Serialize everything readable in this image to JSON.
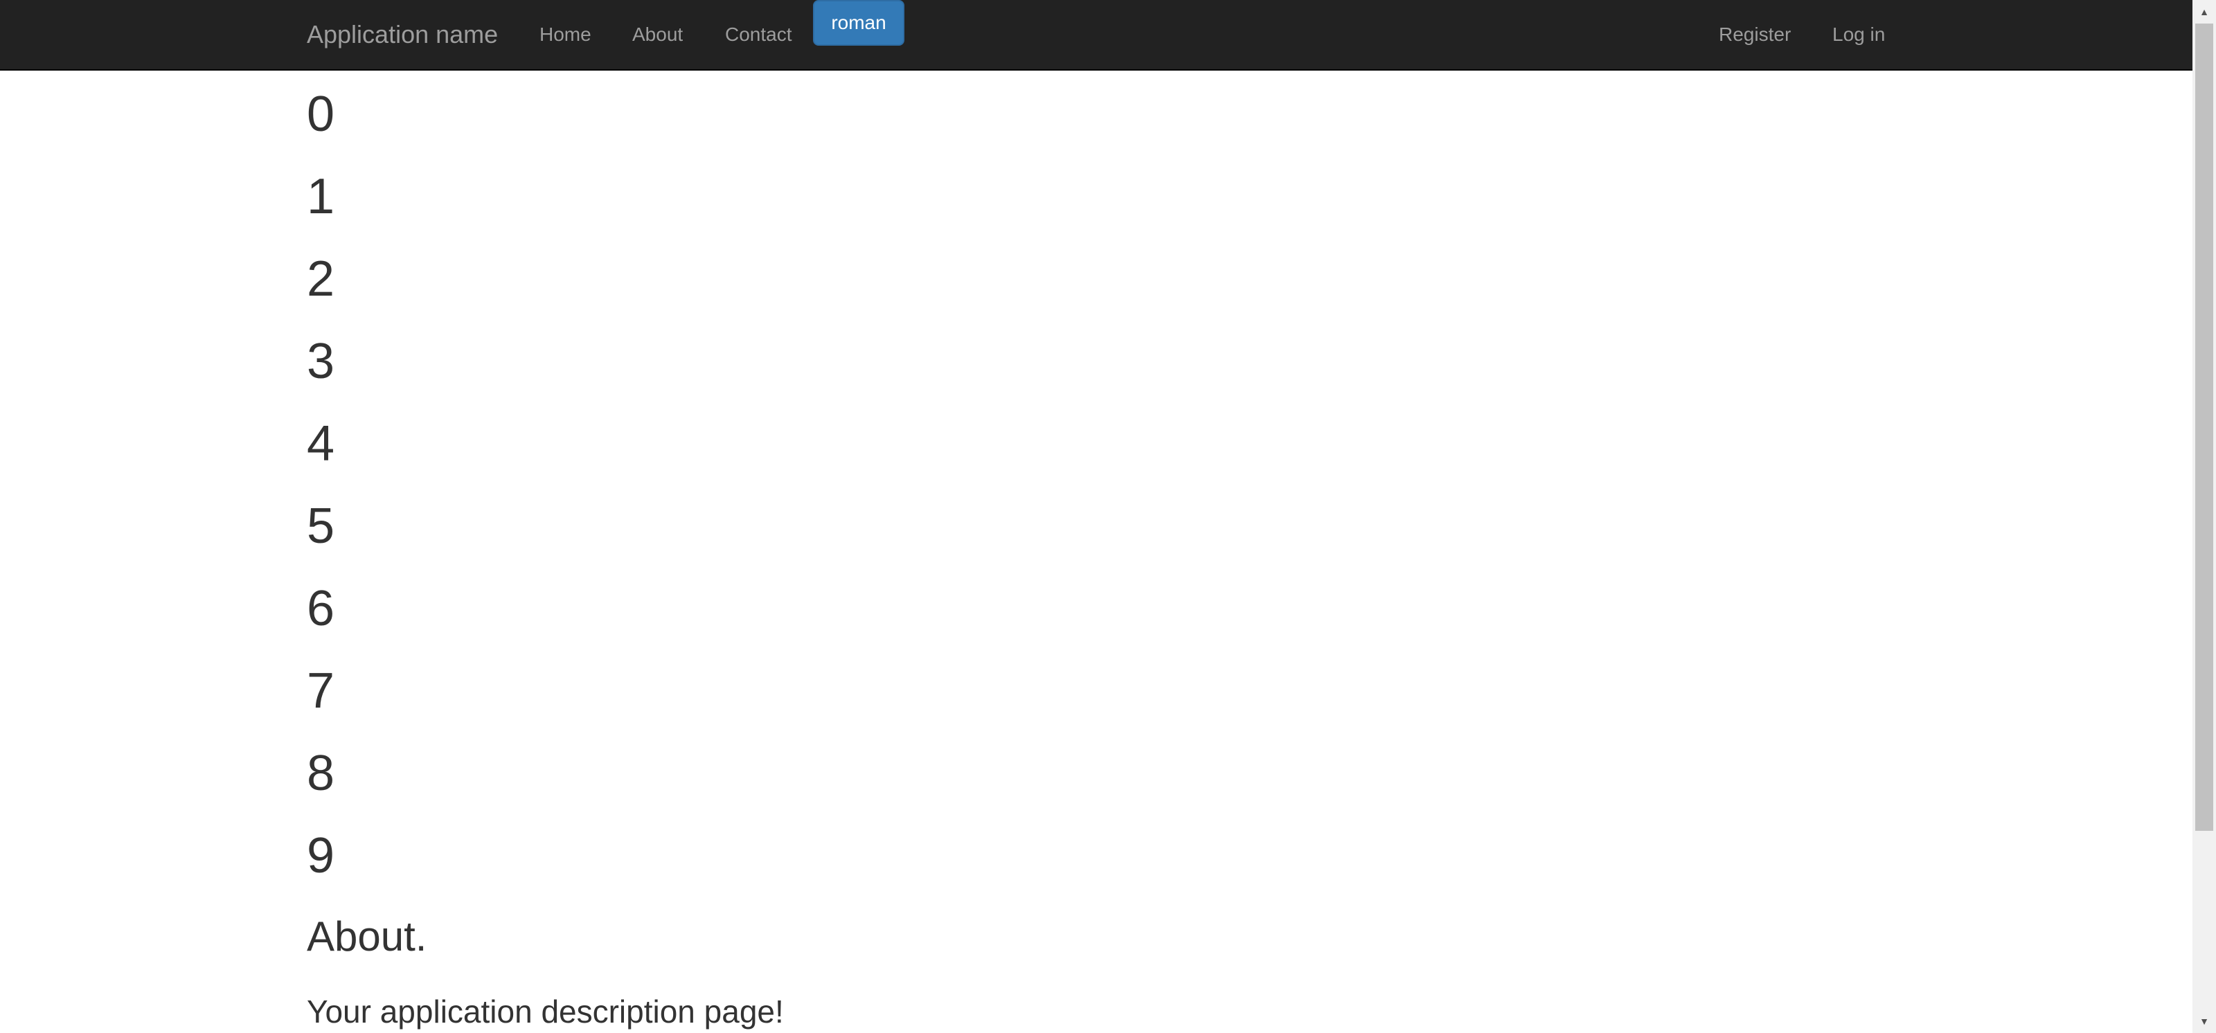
{
  "navbar": {
    "brand": "Application name",
    "links": {
      "home": "Home",
      "about": "About",
      "contact": "Contact"
    },
    "user_button": "roman",
    "right_links": {
      "register": "Register",
      "login": "Log in"
    }
  },
  "main": {
    "numbers": [
      "0",
      "1",
      "2",
      "3",
      "4",
      "5",
      "6",
      "7",
      "8",
      "9"
    ],
    "title": "About.",
    "description": "Your application description page!"
  },
  "scrollbar": {
    "up_icon": "triangle-up-icon",
    "down_icon": "triangle-down-icon"
  },
  "colors": {
    "navbar_bg": "#222222",
    "nav_text": "#9d9d9d",
    "button_bg": "#337ab7",
    "body_text": "#333333"
  }
}
